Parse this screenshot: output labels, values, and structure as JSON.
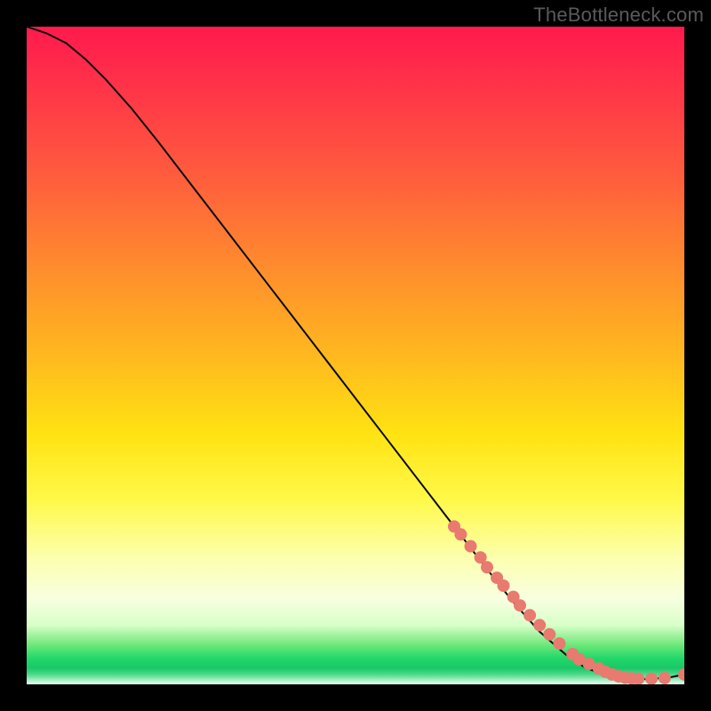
{
  "watermark": "TheBottleneck.com",
  "plot": {
    "size": 740,
    "gradient_colors": [
      "#ff1a4d",
      "#ff5a3e",
      "#ffb81f",
      "#fff94a",
      "#f8ffe0",
      "#23d86a",
      "#eafff2"
    ]
  },
  "chart_data": {
    "type": "line",
    "title": "",
    "xlabel": "",
    "ylabel": "",
    "xlim": [
      0,
      100
    ],
    "ylim": [
      0,
      100
    ],
    "series": [
      {
        "name": "curve",
        "x": [
          0,
          3,
          6,
          9,
          12,
          16,
          20,
          25,
          30,
          35,
          40,
          45,
          50,
          55,
          60,
          65,
          70,
          74,
          78,
          82,
          85,
          88,
          90,
          92,
          94,
          96,
          98,
          100
        ],
        "y": [
          100,
          99,
          97.5,
          95,
          92,
          87.5,
          82.5,
          76,
          69.5,
          63,
          56.5,
          50,
          43.5,
          37,
          30.5,
          24,
          17.5,
          12.5,
          8,
          4.5,
          2.5,
          1.4,
          1.0,
          0.8,
          0.8,
          0.9,
          1.1,
          1.5
        ]
      }
    ],
    "points": {
      "name": "highlight-dots",
      "color": "#e87a6f",
      "x": [
        65,
        66,
        67.5,
        69,
        70,
        71.5,
        72.5,
        74,
        75,
        76.5,
        78,
        79.5,
        81,
        83,
        84,
        85.5,
        87,
        88,
        89,
        90,
        91,
        92,
        93,
        95,
        97,
        100
      ],
      "y": [
        24,
        22.8,
        21,
        19.3,
        17.8,
        16.2,
        15,
        13.3,
        12,
        10.5,
        9,
        7.6,
        6.2,
        4.6,
        3.8,
        3.1,
        2.4,
        1.9,
        1.5,
        1.2,
        1.0,
        0.9,
        0.85,
        0.85,
        0.95,
        1.5
      ]
    }
  }
}
